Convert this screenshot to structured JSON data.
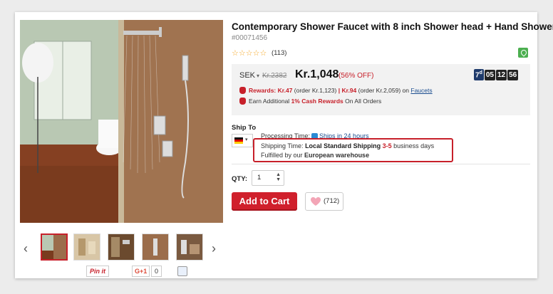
{
  "product": {
    "title": "Contemporary Shower Faucet with 8 inch Shower head + Hand Shower",
    "sku": "#00071456",
    "stars": "☆☆☆☆☆",
    "review_count": "(113)"
  },
  "price": {
    "currency": "SEK",
    "old_price": "Kr.2382",
    "new_price": "Kr.1,048",
    "discount": "(56% OFF)",
    "timer": {
      "days": "7",
      "days_suffix": "d",
      "hours": "05",
      "minutes": "12",
      "seconds": "56"
    },
    "rewards_label": "Rewards: Kr.47",
    "rewards_order": "(order Kr.1,123)",
    "rewards_sep": "|",
    "rewards_label2": "Kr.94",
    "rewards_order2": "(order Kr.2,059) on",
    "rewards_link": "Faucets",
    "cash_prefix": "Earn Additional",
    "cash_highlight": "1% Cash Rewards",
    "cash_suffix": "On All Orders"
  },
  "shipping": {
    "label": "Ship To",
    "processing_label": "Processing Time:",
    "processing_value": "Ships in 24 hours",
    "time_label": "Shipping Time:",
    "time_method": "Local Standard Shipping",
    "time_days": "3-5",
    "time_suffix": "business days",
    "fulfilled_prefix": "Fulfilled by our",
    "fulfilled_value": "European warehouse"
  },
  "quantity": {
    "label": "QTY:",
    "value": "1"
  },
  "actions": {
    "add_to_cart": "Add to Cart",
    "wishlist_count": "(712)"
  },
  "social": {
    "pinterest": "Pin it",
    "gplus": "G+1",
    "gplus_count": "0"
  },
  "colors": {
    "accent": "#c7202a",
    "link": "#1a4d8f",
    "price_bg": "#f2f2f2"
  }
}
